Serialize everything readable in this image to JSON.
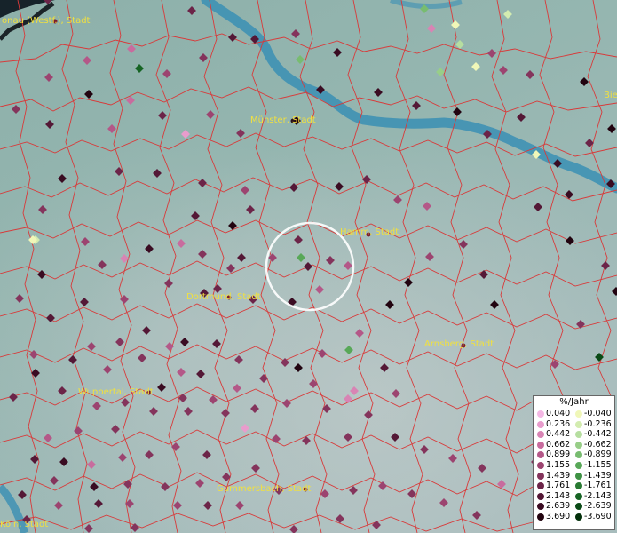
{
  "map": {
    "cities": [
      {
        "id": "borken",
        "name": "onau (Westf.), Stadt"
      },
      {
        "id": "muenster",
        "name": "Münster, Stadt"
      },
      {
        "id": "hamm",
        "name": "Hamm, Stadt"
      },
      {
        "id": "dortmund",
        "name": "Dortmund, Stadt"
      },
      {
        "id": "arnsberg",
        "name": "Arnsberg, Stadt"
      },
      {
        "id": "wuppertal",
        "name": "Wuppertal, Stadt"
      },
      {
        "id": "gummersbach",
        "name": "Gummersbach, Stadt"
      },
      {
        "id": "koeln",
        "name": "Köln, Stadt"
      },
      {
        "id": "bielefeld",
        "name": "Bie"
      }
    ]
  },
  "legend": {
    "title": "%/Jahr",
    "rows": [
      {
        "pos": "0.040",
        "neg": "-0.040",
        "pos_color": "#f4b8e4",
        "neg_color": "#f0f7b8"
      },
      {
        "pos": "0.236",
        "neg": "-0.236",
        "pos_color": "#e89ccc",
        "neg_color": "#d3ecb0"
      },
      {
        "pos": "0.442",
        "neg": "-0.442",
        "pos_color": "#d884b4",
        "neg_color": "#b6dea0"
      },
      {
        "pos": "0.662",
        "neg": "-0.662",
        "pos_color": "#c86c9e",
        "neg_color": "#98ce88"
      },
      {
        "pos": "0.899",
        "neg": "-0.899",
        "pos_color": "#b45888",
        "neg_color": "#78bc70"
      },
      {
        "pos": "1.155",
        "neg": "-1.155",
        "pos_color": "#9c4470",
        "neg_color": "#58a858"
      },
      {
        "pos": "1.439",
        "neg": "-1.439",
        "pos_color": "#84345c",
        "neg_color": "#3e9244"
      },
      {
        "pos": "1.761",
        "neg": "-1.761",
        "pos_color": "#6c2448",
        "neg_color": "#287a32"
      },
      {
        "pos": "2.143",
        "neg": "-2.143",
        "pos_color": "#541836",
        "neg_color": "#166424"
      },
      {
        "pos": "2.639",
        "neg": "-2.639",
        "pos_color": "#3a0c22",
        "neg_color": "#0a4a16"
      },
      {
        "pos": "3.690",
        "neg": "-3.690",
        "pos_color": "#220410",
        "neg_color": "#02300a"
      }
    ]
  }
}
